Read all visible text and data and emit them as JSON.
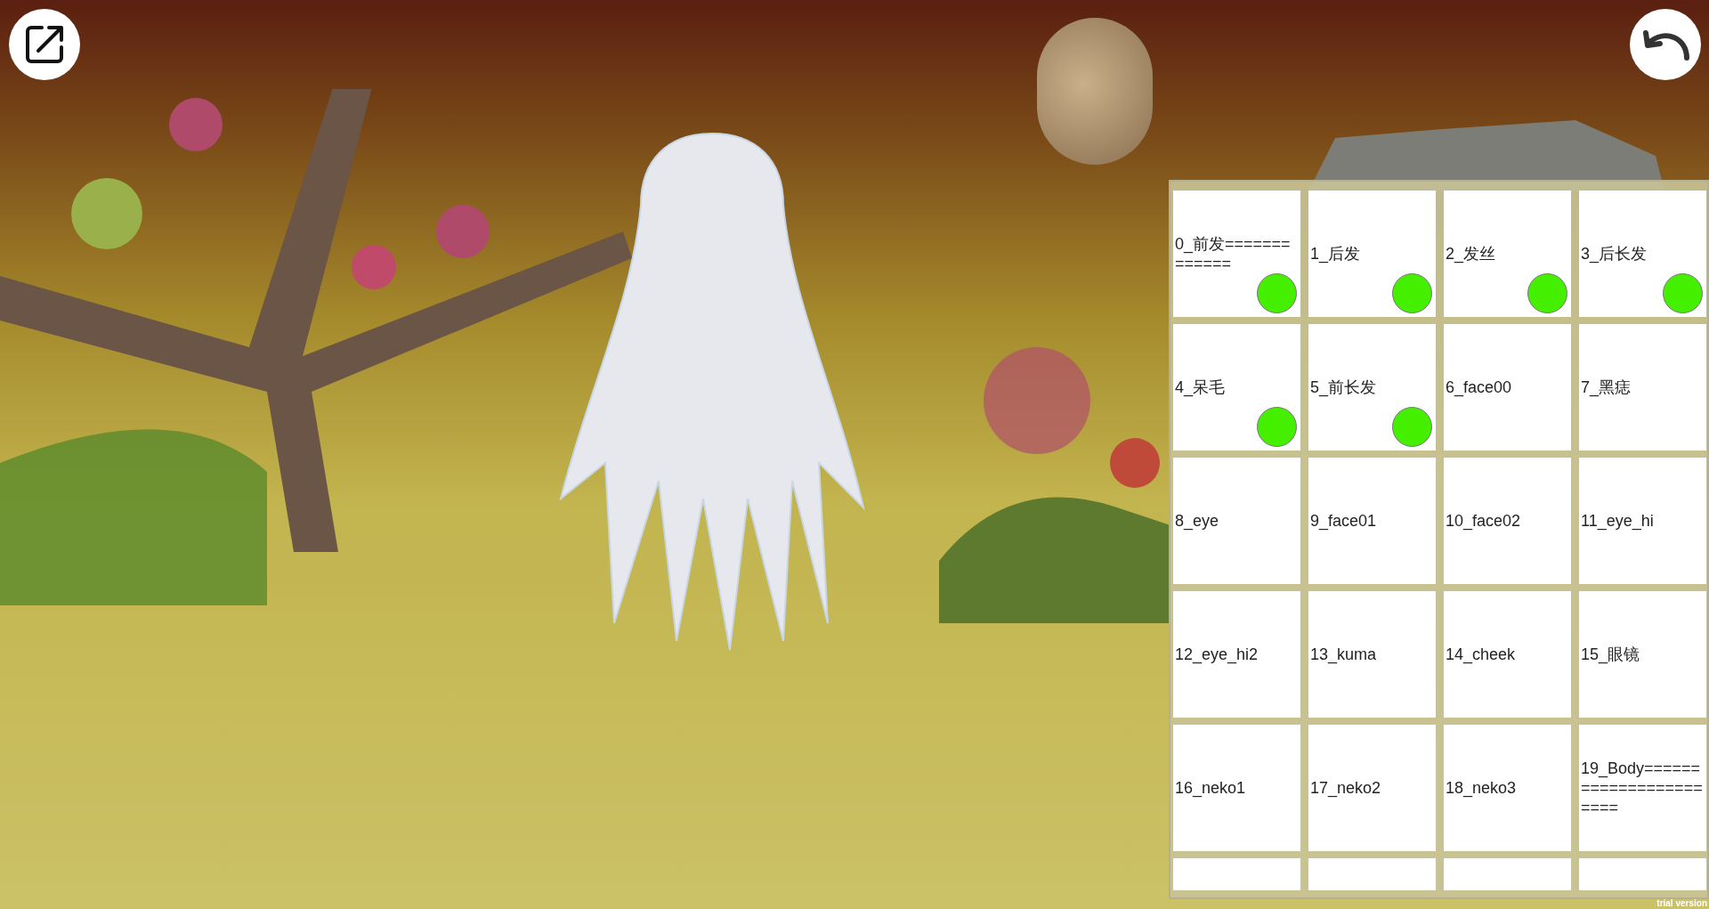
{
  "toolbar": {
    "left_button": {
      "kind": "external"
    },
    "right_button": {
      "kind": "undo"
    }
  },
  "parts_grid": {
    "cells": [
      {
        "label": "0_前发=============",
        "marked": true
      },
      {
        "label": "1_后发",
        "marked": true
      },
      {
        "label": "2_发丝",
        "marked": true
      },
      {
        "label": "3_后长发",
        "marked": true
      },
      {
        "label": "4_呆毛",
        "marked": true
      },
      {
        "label": "5_前长发",
        "marked": true
      },
      {
        "label": "6_face00",
        "marked": false
      },
      {
        "label": "7_黑痣",
        "marked": false
      },
      {
        "label": "8_eye",
        "marked": false
      },
      {
        "label": "9_face01",
        "marked": false
      },
      {
        "label": "10_face02",
        "marked": false
      },
      {
        "label": "11_eye_hi",
        "marked": false
      },
      {
        "label": "12_eye_hi2",
        "marked": false
      },
      {
        "label": "13_kuma",
        "marked": false
      },
      {
        "label": "14_cheek",
        "marked": false
      },
      {
        "label": "15_眼镜",
        "marked": false
      },
      {
        "label": "16_neko1",
        "marked": false
      },
      {
        "label": "17_neko2",
        "marked": false
      },
      {
        "label": "18_neko3",
        "marked": false
      },
      {
        "label": "19_Body=======================",
        "marked": false
      }
    ]
  },
  "footer": {
    "note": "trial version"
  }
}
